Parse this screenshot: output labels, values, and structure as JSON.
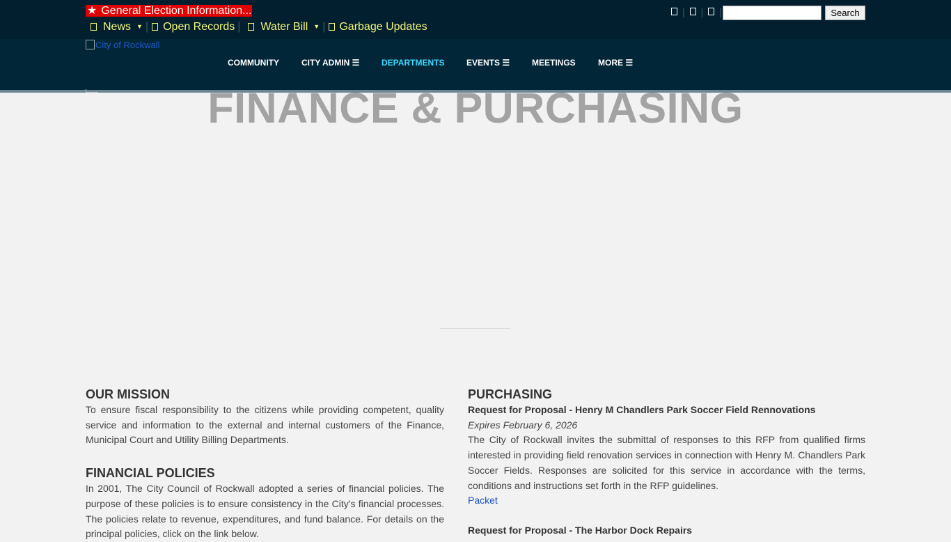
{
  "topbar": {
    "alert": {
      "icon": "star-icon",
      "label": "General Election Information..."
    },
    "quicklinks": [
      {
        "label": "News",
        "icon": "newspaper-icon",
        "dropdown": true
      },
      {
        "label": "Open Records",
        "icon": "document-icon",
        "dropdown": false
      },
      {
        "label": "Water Bill",
        "icon": "water-drop-icon",
        "dropdown": true
      },
      {
        "label": "Garbage Updates",
        "icon": "trash-icon",
        "dropdown": false
      }
    ],
    "utility_icons": [
      "translate-icon",
      "accessibility-icon",
      "font-size-icon"
    ],
    "search": {
      "placeholder": "",
      "value": "",
      "button_label": "Search"
    }
  },
  "nav": {
    "logo_alt": "City of Rockwall",
    "items": [
      {
        "label": "COMMUNITY"
      },
      {
        "label": "CITY ADMIN ☰"
      },
      {
        "label": "DEPARTMENTS",
        "active": true
      },
      {
        "label": "EVENTS ☰"
      },
      {
        "label": "MEETINGS"
      },
      {
        "label": "MORE ☰"
      }
    ]
  },
  "hero": {
    "title": "FINANCE & PURCHASING"
  },
  "main": {
    "mission": {
      "heading": "OUR MISSION",
      "text": "To ensure fiscal responsibility to the citizens while providing competent, quality service and information to the external and internal customers of the Finance, Municipal Court and Utility Billing Departments."
    },
    "policies": {
      "heading": "FINANCIAL POLICIES",
      "text": "In 2001, The City Council of Rockwall adopted a series of financial policies. The purpose of these policies is to ensure consistency in the City's financial processes. The policies relate to revenue, expenditures, and fund balance. For details on the principal policies, click on the link below."
    },
    "purchasing": {
      "heading": "PURCHASING",
      "rfps": [
        {
          "title": "Request for Proposal - Henry M Chandlers Park Soccer Field Rennovations",
          "expires": "Expires February 6, 2026",
          "text": "The City of Rockwall invites the submittal of responses to this RFP from qualified firms interested in providing field renovation services in connection with Henry M. Chandlers Park Soccer Fields. Responses are solicited for this service in accordance with the terms, conditions and instructions set forth in the RFP guidelines.",
          "link": "Packet"
        },
        {
          "title": "Request for Proposal - The Harbor Dock Repairs"
        }
      ]
    }
  },
  "colors": {
    "topbar_bg": "#011f2e",
    "nav_bg": "#012638",
    "alert_bg": "#e00000",
    "quicklink": "#f5f57a",
    "nav_active": "#3fd9ff",
    "hero_title": "#a3a3a3",
    "link": "#1a4fc4"
  }
}
